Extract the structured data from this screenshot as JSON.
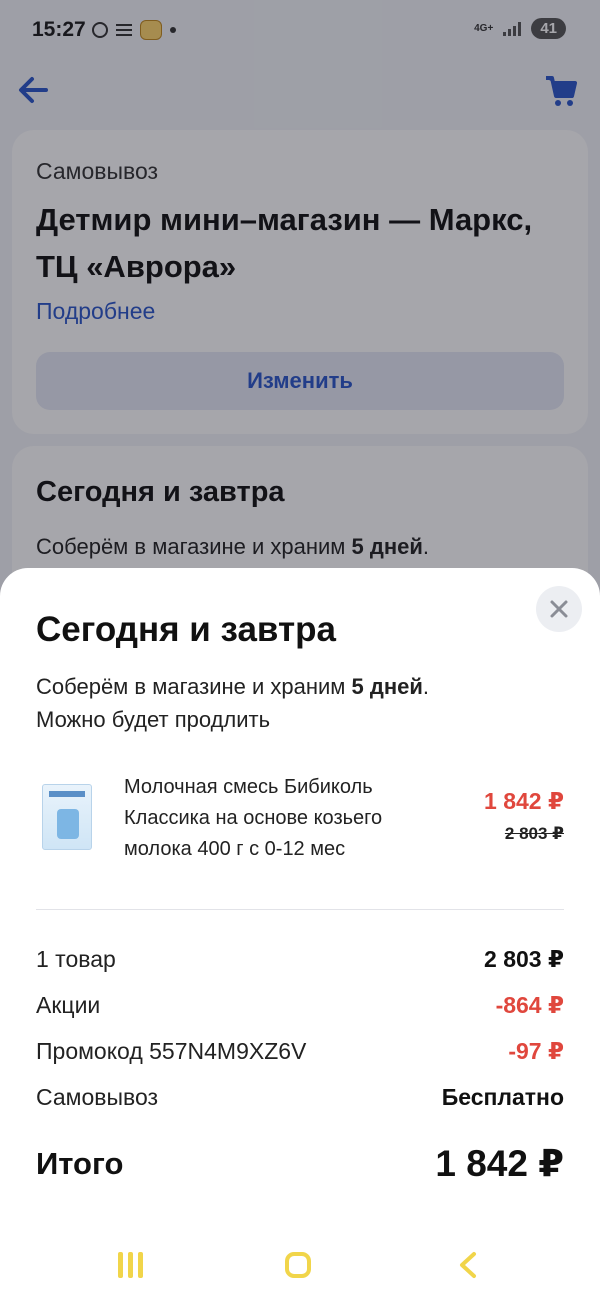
{
  "status_bar": {
    "time": "15:27",
    "network": "4G+",
    "battery": "41",
    "icons": [
      "check-circle-icon",
      "lines-icon",
      "face-icon",
      "dot-icon",
      "signal-icon"
    ]
  },
  "top_bar": {
    "icons": [
      "back-arrow-icon",
      "cart-icon"
    ],
    "accent_color": "#2b56c9"
  },
  "pickup_card": {
    "type": "Самовывоз",
    "store_name": "Детмир мини–магазин — Маркс, ТЦ «Аврора»",
    "more_link": "Подробнее",
    "change_button": "Изменить"
  },
  "delivery_card": {
    "title": "Сегодня и завтра",
    "desc_prefix": "Соберём в магазине и храним ",
    "desc_days": "5 дней",
    "desc_suffix": "."
  },
  "sheet": {
    "title": "Сегодня и завтра",
    "desc_prefix": "Соберём в магазине и храним ",
    "desc_days": "5 дней",
    "desc_suffix": ".",
    "desc_line2": "Можно будет продлить",
    "product": {
      "name": "Молочная смесь Бибиколь Классика на основе козьего молока 400 г с 0-12 мес",
      "price_new": "1 842 ₽",
      "price_old": "2 803 ₽"
    },
    "summary": [
      {
        "label": "1 товар",
        "value": "2 803 ₽",
        "highlight": false
      },
      {
        "label": "Акции",
        "value": "-864 ₽",
        "highlight": true
      },
      {
        "label": "Промокод 557N4M9XZ6V",
        "value": "-97 ₽",
        "highlight": true
      },
      {
        "label": "Самовывоз",
        "value": "Бесплатно",
        "highlight": false
      }
    ],
    "total_label": "Итого",
    "total_value": "1 842 ₽",
    "discount_color": "#e0473d"
  },
  "nav_bar": {
    "icons": [
      "recent-apps-icon",
      "home-icon",
      "back-icon"
    ],
    "color": "#f1d54a"
  }
}
